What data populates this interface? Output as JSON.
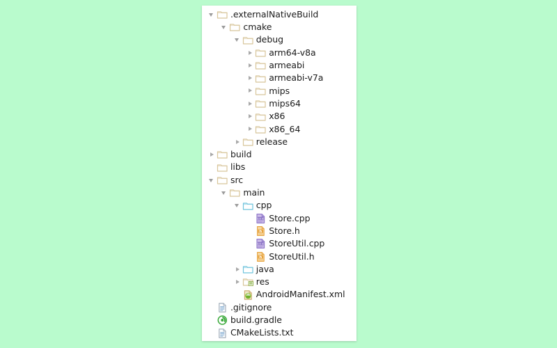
{
  "panel": {
    "name": "project-file-tree",
    "background": "#ffffff"
  },
  "canvas": {
    "background": "#b9fbcd"
  },
  "colors": {
    "folder_tan": "#d8c59a",
    "folder_tan_fill": "#ffffff",
    "folder_blue": "#6fc3dc",
    "arrow_gray": "#a9a9a9",
    "cpp_purple": "#8e76c8",
    "header_orange": "#e8a33d",
    "gradle_green": "#3aa93a",
    "text": "#1a1a1a"
  },
  "tree": {
    "items": [
      {
        "label": ".externalNativeBuild",
        "depth": 0,
        "arrow": "expanded",
        "icon": "folder-tan-icon",
        "type": "folder"
      },
      {
        "label": "cmake",
        "depth": 1,
        "arrow": "expanded",
        "icon": "folder-tan-icon",
        "type": "folder"
      },
      {
        "label": "debug",
        "depth": 2,
        "arrow": "expanded",
        "icon": "folder-tan-icon",
        "type": "folder"
      },
      {
        "label": "arm64-v8a",
        "depth": 3,
        "arrow": "collapsed",
        "icon": "folder-tan-icon",
        "type": "folder"
      },
      {
        "label": "armeabi",
        "depth": 3,
        "arrow": "collapsed",
        "icon": "folder-tan-icon",
        "type": "folder"
      },
      {
        "label": "armeabi-v7a",
        "depth": 3,
        "arrow": "collapsed",
        "icon": "folder-tan-icon",
        "type": "folder"
      },
      {
        "label": "mips",
        "depth": 3,
        "arrow": "collapsed",
        "icon": "folder-tan-icon",
        "type": "folder"
      },
      {
        "label": "mips64",
        "depth": 3,
        "arrow": "collapsed",
        "icon": "folder-tan-icon",
        "type": "folder"
      },
      {
        "label": "x86",
        "depth": 3,
        "arrow": "collapsed",
        "icon": "folder-tan-icon",
        "type": "folder"
      },
      {
        "label": "x86_64",
        "depth": 3,
        "arrow": "collapsed",
        "icon": "folder-tan-icon",
        "type": "folder"
      },
      {
        "label": "release",
        "depth": 2,
        "arrow": "collapsed",
        "icon": "folder-tan-icon",
        "type": "folder"
      },
      {
        "label": "build",
        "depth": 0,
        "arrow": "collapsed",
        "icon": "folder-tan-icon",
        "type": "folder"
      },
      {
        "label": "libs",
        "depth": 0,
        "arrow": "none",
        "icon": "folder-tan-icon",
        "type": "folder"
      },
      {
        "label": "src",
        "depth": 0,
        "arrow": "expanded",
        "icon": "folder-tan-icon",
        "type": "folder"
      },
      {
        "label": "main",
        "depth": 1,
        "arrow": "expanded",
        "icon": "folder-tan-icon",
        "type": "folder"
      },
      {
        "label": "cpp",
        "depth": 2,
        "arrow": "expanded",
        "icon": "folder-blue-icon",
        "type": "folder"
      },
      {
        "label": "Store.cpp",
        "depth": 3,
        "arrow": "none",
        "icon": "file-cpp-icon",
        "type": "file"
      },
      {
        "label": "Store.h",
        "depth": 3,
        "arrow": "none",
        "icon": "file-header-icon",
        "type": "file"
      },
      {
        "label": "StoreUtil.cpp",
        "depth": 3,
        "arrow": "none",
        "icon": "file-cpp-icon",
        "type": "file"
      },
      {
        "label": "StoreUtil.h",
        "depth": 3,
        "arrow": "none",
        "icon": "file-header-icon",
        "type": "file"
      },
      {
        "label": "java",
        "depth": 2,
        "arrow": "collapsed",
        "icon": "folder-blue-icon",
        "type": "folder"
      },
      {
        "label": "res",
        "depth": 2,
        "arrow": "collapsed",
        "icon": "folder-res-icon",
        "type": "folder"
      },
      {
        "label": "AndroidManifest.xml",
        "depth": 2,
        "arrow": "none",
        "icon": "file-android-icon",
        "type": "file"
      },
      {
        "label": ".gitignore",
        "depth": 0,
        "arrow": "none",
        "icon": "file-text-icon",
        "type": "file"
      },
      {
        "label": "build.gradle",
        "depth": 0,
        "arrow": "none",
        "icon": "file-gradle-icon",
        "type": "file"
      },
      {
        "label": "CMakeLists.txt",
        "depth": 0,
        "arrow": "none",
        "icon": "file-text-icon",
        "type": "file"
      }
    ]
  }
}
